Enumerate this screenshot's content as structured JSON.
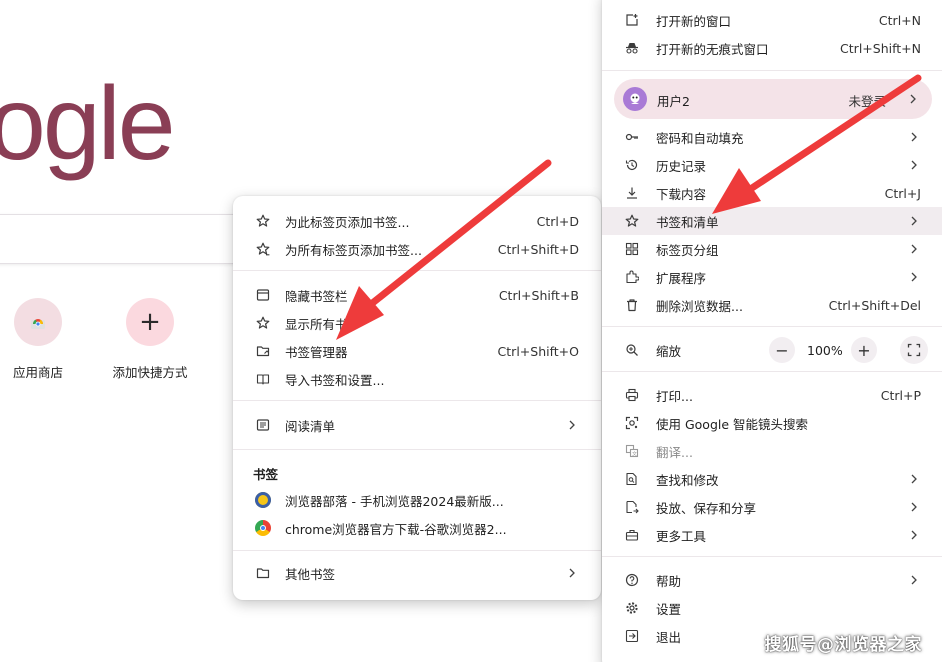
{
  "ntp": {
    "logo_text": "ogle",
    "shortcuts": [
      {
        "label": "应用商店"
      },
      {
        "label": "添加快捷方式",
        "glyph": "+"
      }
    ]
  },
  "main_menu": {
    "new_window": {
      "label": "打开新的窗口",
      "shortcut": "Ctrl+N"
    },
    "incognito": {
      "label": "打开新的无痕式窗口",
      "shortcut": "Ctrl+Shift+N"
    },
    "profile": {
      "name": "用户2",
      "status": "未登录"
    },
    "passwords": {
      "label": "密码和自动填充"
    },
    "history": {
      "label": "历史记录"
    },
    "downloads": {
      "label": "下载内容",
      "shortcut": "Ctrl+J"
    },
    "bookmarks": {
      "label": "书签和清单"
    },
    "tab_groups": {
      "label": "标签页分组"
    },
    "extensions": {
      "label": "扩展程序"
    },
    "clear_data": {
      "label": "删除浏览数据...",
      "shortcut": "Ctrl+Shift+Del"
    },
    "zoom": {
      "label": "缩放",
      "minus": "−",
      "value": "100%",
      "plus": "+"
    },
    "print": {
      "label": "打印...",
      "shortcut": "Ctrl+P"
    },
    "lens": {
      "label": "使用 Google 智能镜头搜索"
    },
    "translate": {
      "label": "翻译..."
    },
    "find": {
      "label": "查找和修改"
    },
    "cast": {
      "label": "投放、保存和分享"
    },
    "more_tools": {
      "label": "更多工具"
    },
    "help": {
      "label": "帮助"
    },
    "settings": {
      "label": "设置"
    },
    "exit": {
      "label": "退出"
    }
  },
  "sub_menu": {
    "bookmark_tab": {
      "label": "为此标签页添加书签...",
      "shortcut": "Ctrl+D"
    },
    "bookmark_all": {
      "label": "为所有标签页添加书签...",
      "shortcut": "Ctrl+Shift+D"
    },
    "hide_bar": {
      "label": "隐藏书签栏",
      "shortcut": "Ctrl+Shift+B"
    },
    "show_all": {
      "label": "显示所有书"
    },
    "manager": {
      "label": "书签管理器",
      "shortcut": "Ctrl+Shift+O"
    },
    "import": {
      "label": "导入书签和设置..."
    },
    "reading_list": {
      "label": "阅读清单"
    },
    "bookmarks_heading": "书签",
    "bookmark_items": [
      {
        "label": "浏览器部落 - 手机浏览器2024最新版..."
      },
      {
        "label": "chrome浏览器官方下载-谷歌浏览器2..."
      }
    ],
    "other": {
      "label": "其他书签"
    }
  },
  "watermark": "搜狐号@浏览器之家",
  "colors": {
    "accent": "#8a3e55",
    "arrow": "#ee3b3b",
    "menu_highlight": "#f1ecef",
    "profile_bg": "#f4e3e8"
  }
}
